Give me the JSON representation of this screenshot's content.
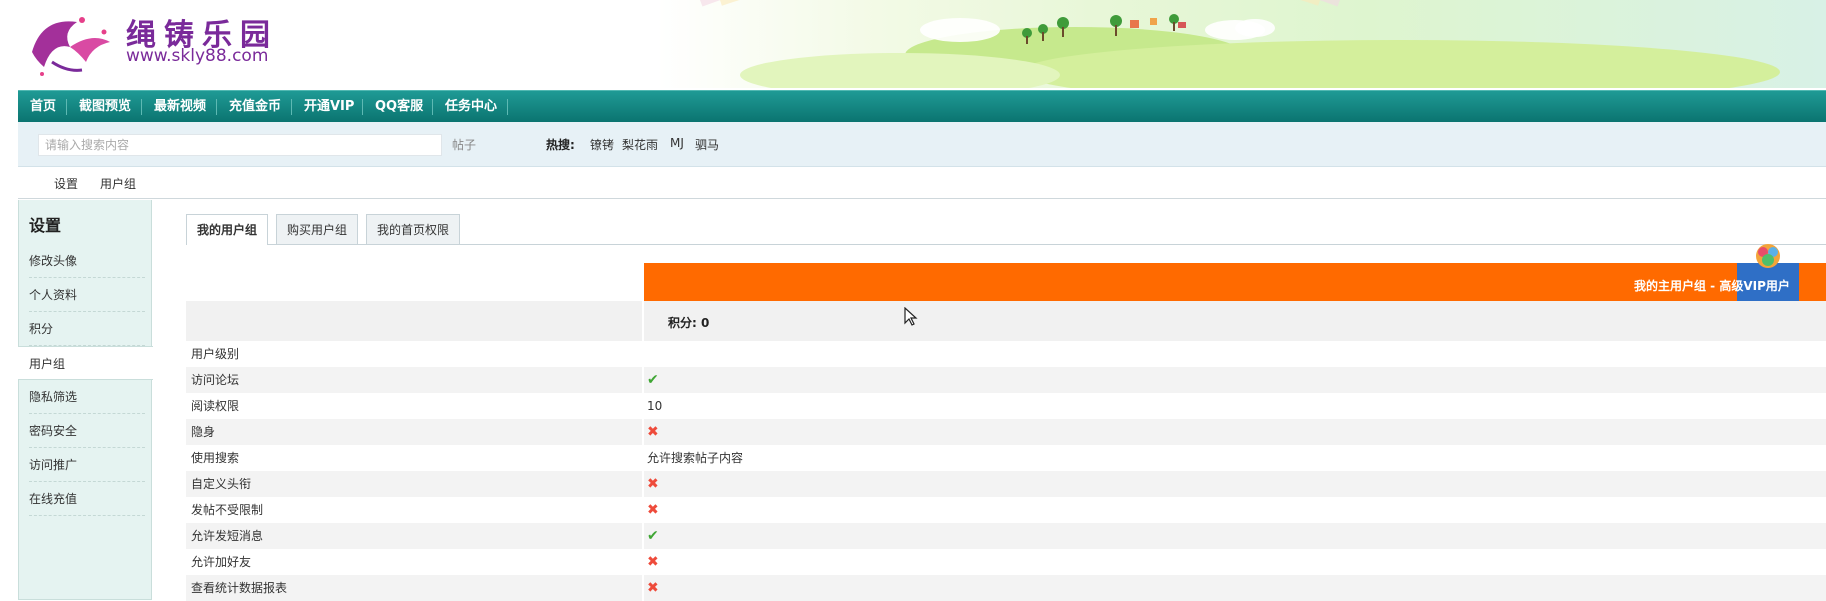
{
  "site": {
    "title": "绳铸乐园",
    "url": "www.skly88.com"
  },
  "nav": {
    "items": [
      {
        "label": "首页"
      },
      {
        "label": "截图预览"
      },
      {
        "label": "最新视频"
      },
      {
        "label": "充值金币"
      },
      {
        "label": "开通VIP"
      },
      {
        "label": "QQ客服"
      },
      {
        "label": "任务中心"
      }
    ]
  },
  "search": {
    "placeholder": "请输入搜索内容",
    "type": "帖子",
    "hot_label": "热搜:",
    "hot_keywords": [
      "镣铐",
      "梨花雨",
      "MJ",
      "驷马"
    ]
  },
  "breadcrumb": [
    "设置",
    "用户组"
  ],
  "sidebar": {
    "title": "设置",
    "items": [
      {
        "label": "修改头像"
      },
      {
        "label": "个人资料"
      },
      {
        "label": "积分"
      },
      {
        "label": "用户组",
        "active": true
      },
      {
        "label": "隐私筛选"
      },
      {
        "label": "密码安全"
      },
      {
        "label": "访问推广"
      },
      {
        "label": "在线充值"
      }
    ]
  },
  "tabs": [
    {
      "label": "我的用户组",
      "active": true
    },
    {
      "label": "购买用户组"
    },
    {
      "label": "我的首页权限"
    }
  ],
  "usergroup": {
    "header_prefix": "我的主用户组 - 高级",
    "vip_label": "VIP用户",
    "points_label": "积分: 0"
  },
  "permissions": [
    {
      "label": "用户级别",
      "value": ""
    },
    {
      "label": "访问论坛",
      "value": "",
      "status": "yes"
    },
    {
      "label": "阅读权限",
      "value": "10"
    },
    {
      "label": "隐身",
      "value": "",
      "status": "no"
    },
    {
      "label": "使用搜索",
      "value": "允许搜索帖子内容"
    },
    {
      "label": "自定义头衔",
      "value": "",
      "status": "no"
    },
    {
      "label": "发帖不受限制",
      "value": "",
      "status": "no"
    },
    {
      "label": "允许发短消息",
      "value": "",
      "status": "yes"
    },
    {
      "label": "允许加好友",
      "value": "",
      "status": "no"
    },
    {
      "label": "查看统计数据报表",
      "value": "",
      "status": "no"
    }
  ],
  "icons": {
    "yes": "check-icon",
    "no": "cross-icon"
  },
  "colors": {
    "nav": "#0e7f7a",
    "vip_header": "#ff6a00",
    "vip_cell": "#2f6fc6",
    "yes": "#3fa634",
    "no": "#ee4b3b"
  }
}
